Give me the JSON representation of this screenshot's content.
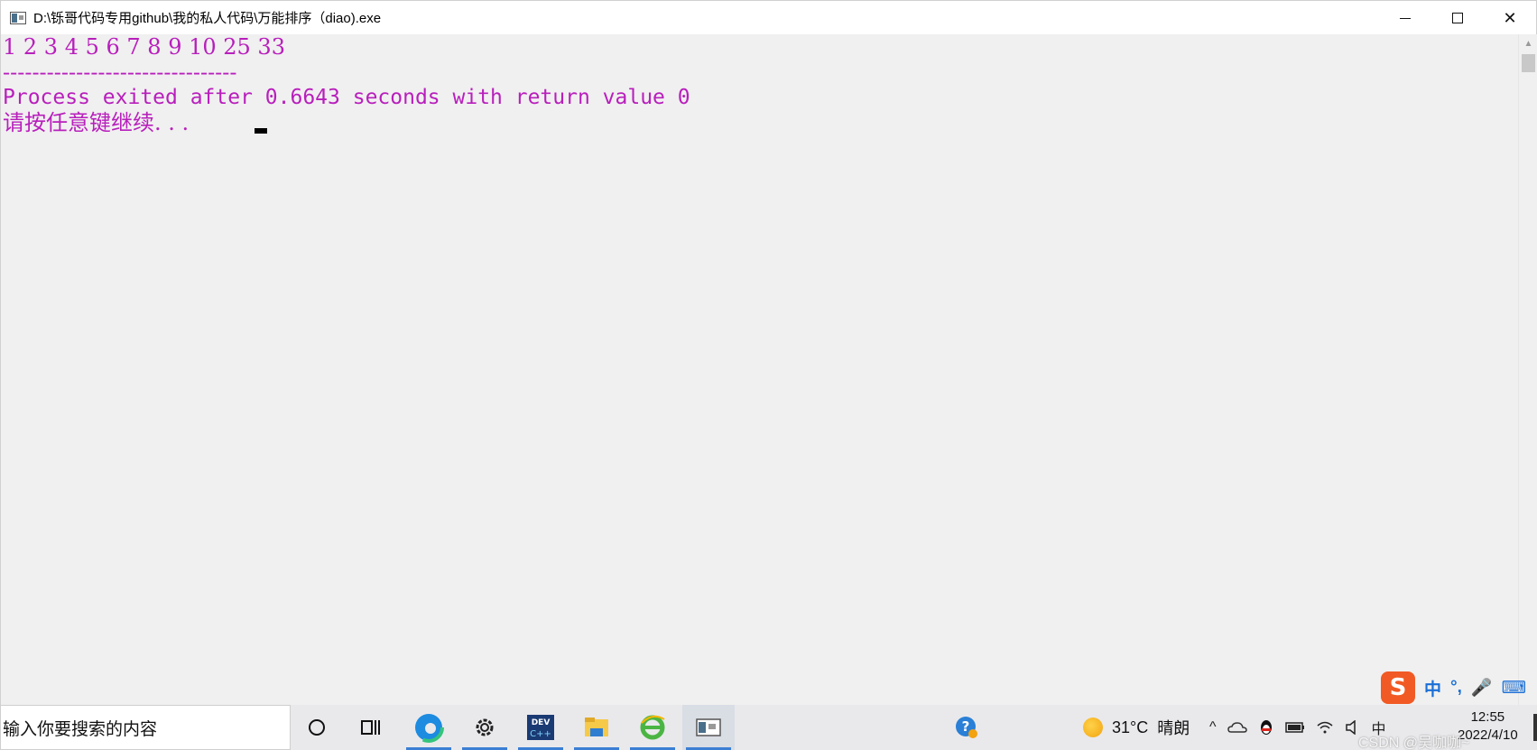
{
  "window": {
    "title": "D:\\铄哥代码专用github\\我的私人代码\\万能排序（diao).exe",
    "min_glyph": "",
    "max_glyph": "",
    "close_glyph": "✕"
  },
  "console": {
    "output_line": "1 2 3 4 5 6 7 8 9 10 25 33",
    "separator": "--------------------------------",
    "exit_line": "Process exited after 0.6643 seconds with return value 0",
    "press_key_line": "请按任意键继续. . .",
    "text_color": "#b81fbc"
  },
  "ime": {
    "logo": "S",
    "mode": "中",
    "punct": "°,",
    "mic": "🎤",
    "keyboard": "⌨",
    "brand_color": "#f15a24"
  },
  "taskbar": {
    "search_placeholder": "输入你要搜索的内容",
    "weather_temp": "31°C",
    "weather_desc": "晴朗",
    "clock_time": "12:55",
    "clock_date": "2022/4/10",
    "watermark": "CSDN @吴咖咖~",
    "tray_up": "^",
    "tray_lang": "中"
  }
}
